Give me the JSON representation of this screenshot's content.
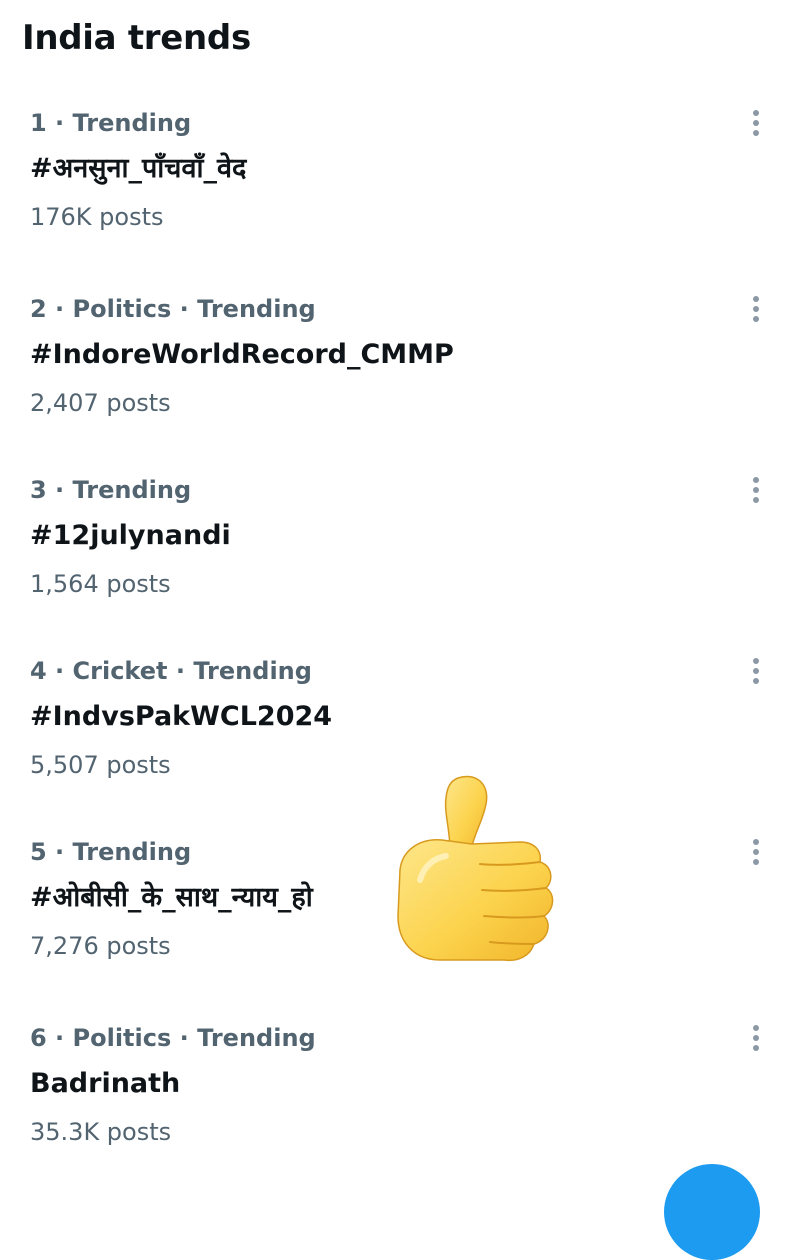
{
  "page": {
    "title": "India trends"
  },
  "trends": [
    {
      "context": "1 · Trending",
      "name": "#अनसुना_पाँचवाँ_वेद",
      "count": "176K posts"
    },
    {
      "context": "2 · Politics · Trending",
      "name": "#IndoreWorldRecord_CMMP",
      "count": "2,407 posts"
    },
    {
      "context": "3 · Trending",
      "name": "#12julynandi",
      "count": "1,564 posts"
    },
    {
      "context": "4 · Cricket · Trending",
      "name": "#IndvsPakWCL2024",
      "count": "5,507 posts"
    },
    {
      "context": "5 · Trending",
      "name": "#ओबीसी_के_साथ_न्याय_हो",
      "count": "7,276 posts"
    },
    {
      "context": "6 · Politics · Trending",
      "name": "Badrinath",
      "count": "35.3K posts"
    }
  ],
  "icons": {
    "more": "more-vertical-icon",
    "sticker": "thumbs-up-emoji",
    "fab": "compose-icon"
  },
  "colors": {
    "primary_text": "#0f1419",
    "secondary_text": "#536471",
    "accent": "#1d9bf0",
    "thumb_fill": "#fcd34d"
  }
}
